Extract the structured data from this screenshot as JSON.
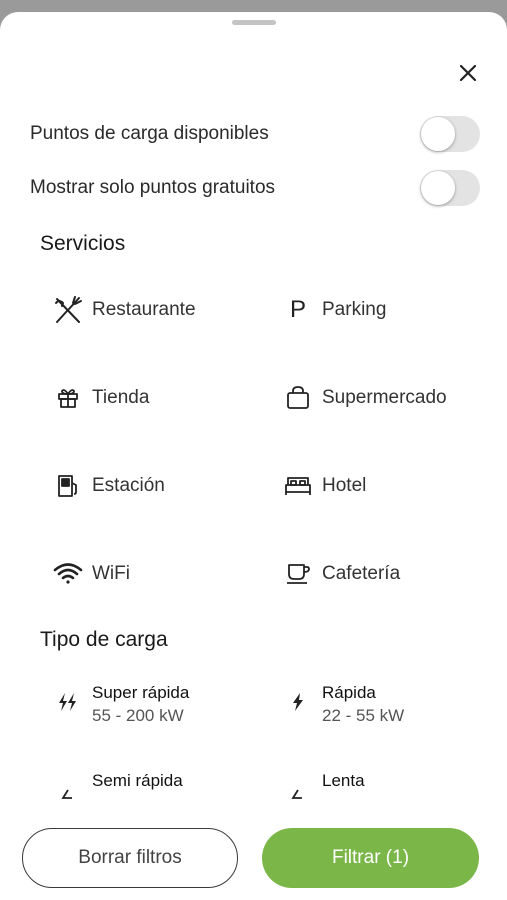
{
  "toggles": [
    {
      "label": "Puntos de carga disponibles",
      "on": false
    },
    {
      "label": "Mostrar solo puntos gratuitos",
      "on": false
    }
  ],
  "services": {
    "title": "Servicios",
    "items": [
      {
        "label": "Restaurante",
        "icon": "fork-knife-icon"
      },
      {
        "label": "Parking",
        "icon": "parking-icon"
      },
      {
        "label": "Tienda",
        "icon": "gift-icon"
      },
      {
        "label": "Supermercado",
        "icon": "shopping-bag-icon"
      },
      {
        "label": "Estación",
        "icon": "fuel-station-icon"
      },
      {
        "label": "Hotel",
        "icon": "bed-icon"
      },
      {
        "label": "WiFi",
        "icon": "wifi-icon"
      },
      {
        "label": "Cafetería",
        "icon": "coffee-cup-icon"
      }
    ]
  },
  "charge_types": {
    "title": "Tipo de carga",
    "items": [
      {
        "name": "Super rápida",
        "range": "55 - 200 kW",
        "icon": "double-bolt-icon"
      },
      {
        "name": "Rápida",
        "range": "22 - 55 kW",
        "icon": "bolt-icon"
      },
      {
        "name": "Semi rápida",
        "range": "",
        "icon": "half-bolt-icon"
      },
      {
        "name": "Lenta",
        "range": "",
        "icon": "half-bolt-icon"
      }
    ]
  },
  "footer": {
    "clear_label": "Borrar filtros",
    "filter_label": "Filtrar (1)"
  },
  "colors": {
    "accent": "#7ab648",
    "toggle_off": "#e3e3e3",
    "overlay": "#9a9a9a"
  },
  "parking_glyph": "P"
}
